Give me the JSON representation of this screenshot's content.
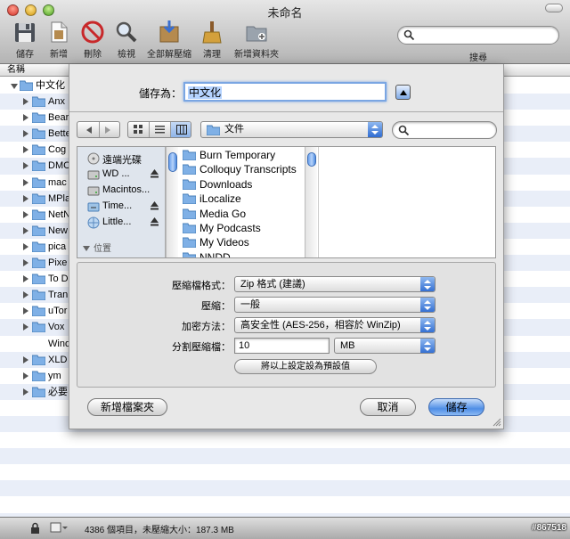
{
  "window": {
    "title": "未命名"
  },
  "toolbar": {
    "items": [
      {
        "label": "儲存",
        "icon": "save-icon"
      },
      {
        "label": "新增",
        "icon": "add-file-icon"
      },
      {
        "label": "刪除",
        "icon": "delete-icon"
      },
      {
        "label": "檢視",
        "icon": "view-icon"
      },
      {
        "label": "全部解壓縮",
        "icon": "extract-all-icon"
      },
      {
        "label": "清理",
        "icon": "clean-icon"
      },
      {
        "label": "新增資料夾",
        "icon": "new-folder-icon"
      }
    ],
    "search_label": "搜尋"
  },
  "list": {
    "header": "名稱",
    "rows": [
      {
        "name": "中文化",
        "level": 0,
        "open": true
      },
      {
        "name": "Anx",
        "level": 1
      },
      {
        "name": "Bear",
        "level": 1
      },
      {
        "name": "Bette",
        "level": 1
      },
      {
        "name": "Cog",
        "level": 1
      },
      {
        "name": "DMC",
        "level": 1
      },
      {
        "name": "mac",
        "level": 1
      },
      {
        "name": "MPla",
        "level": 1
      },
      {
        "name": "NetN",
        "level": 1
      },
      {
        "name": "New",
        "level": 1
      },
      {
        "name": "pica",
        "level": 1
      },
      {
        "name": "Pixe",
        "level": 1
      },
      {
        "name": "To D",
        "level": 1
      },
      {
        "name": "Tran",
        "level": 1
      },
      {
        "name": "uTor",
        "level": 1
      },
      {
        "name": "Vox",
        "level": 1
      },
      {
        "name": "Windows",
        "level": 1,
        "nofolder": true
      },
      {
        "name": "XLD",
        "level": 1
      },
      {
        "name": "ym",
        "level": 1
      },
      {
        "name": "必要",
        "level": 1
      }
    ]
  },
  "status": {
    "text": "4386 個項目，未壓縮大小：187.3 MB",
    "watermark": "#867518"
  },
  "sheet": {
    "save_as_label": "儲存為：",
    "filename": "中文化",
    "path": "文件",
    "sidebar": [
      {
        "label": "遠端光碟",
        "icon": "disc-icon",
        "eject": false
      },
      {
        "label": "WD ...",
        "icon": "drive-icon",
        "eject": true
      },
      {
        "label": "Macintos...",
        "icon": "drive-icon",
        "eject": false
      },
      {
        "label": "Time...",
        "icon": "time-machine-icon",
        "eject": true
      },
      {
        "label": "Little...",
        "icon": "network-icon",
        "eject": true
      }
    ],
    "sidebar_section": "位置",
    "files": [
      "Burn Temporary",
      "Colloquy Transcripts",
      "Downloads",
      "iLocalize",
      "Media Go",
      "My Podcasts",
      "My Videos",
      "NNDD"
    ],
    "options": {
      "format_label": "壓縮檔格式：",
      "format_value": "Zip 格式 (建議)",
      "compression_label": "壓縮：",
      "compression_value": "一般",
      "encryption_label": "加密方法：",
      "encryption_value": "高安全性 (AES-256，相容於 WinZip)",
      "split_label": "分割壓縮檔：",
      "split_value": "10",
      "split_unit": "MB",
      "default_button": "將以上設定設為預設值"
    },
    "new_folder_button": "新增檔案夾",
    "cancel_button": "取消",
    "save_button": "儲存"
  }
}
